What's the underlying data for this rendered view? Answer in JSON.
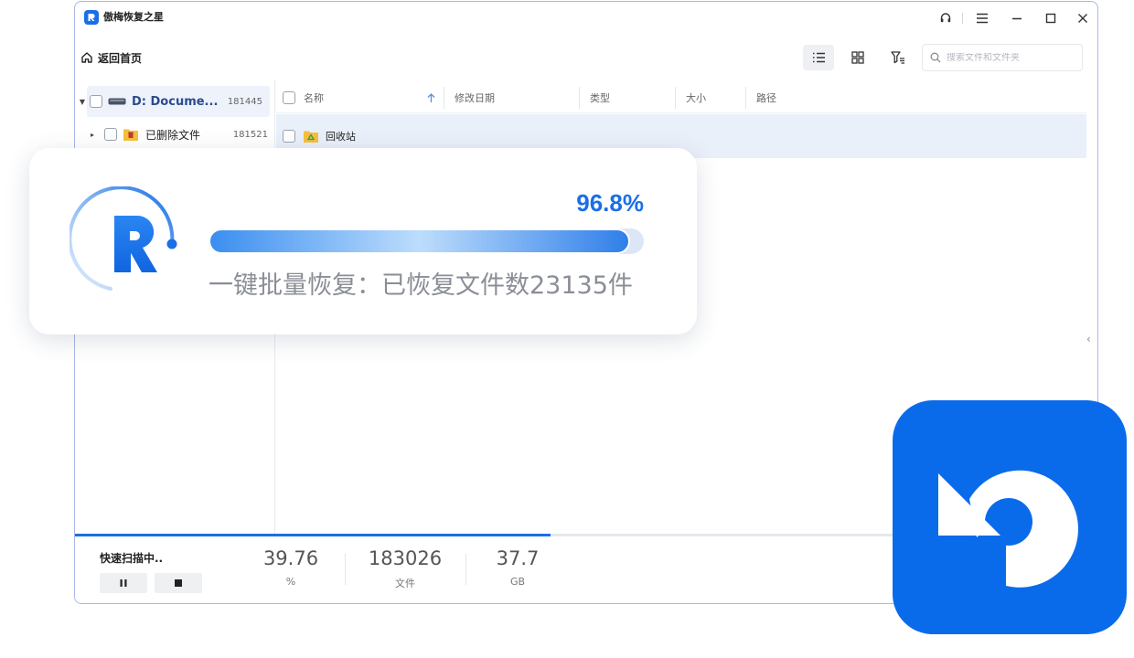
{
  "app": {
    "title": "傲梅恢复之星"
  },
  "toolbar": {
    "back_label": "返回首页",
    "search_placeholder": "搜索文件和文件夹"
  },
  "tree": {
    "drive": {
      "label": "D: Docume...",
      "count": "181445"
    },
    "deleted": {
      "label": "已删除文件",
      "count": "181521"
    }
  },
  "list": {
    "columns": [
      "名称",
      "修改日期",
      "类型",
      "大小",
      "路径"
    ],
    "rows": [
      {
        "name": "回收站"
      }
    ]
  },
  "status": {
    "scan_label": "快速扫描中..",
    "scan_progress": 0.465,
    "stats": [
      {
        "value": "39.76",
        "unit": "%"
      },
      {
        "value": "183026",
        "unit": "文件"
      },
      {
        "value": "37.7",
        "unit": "GB"
      }
    ]
  },
  "overlay": {
    "percent_label": "96.8%",
    "progress": 0.968,
    "message": "一键批量恢复：已恢复文件数23135件"
  },
  "colors": {
    "accent": "#1a6fe6",
    "badge": "#0a6bea",
    "selected_row": "#eaf0fa",
    "folder": "#f6bf3c"
  }
}
